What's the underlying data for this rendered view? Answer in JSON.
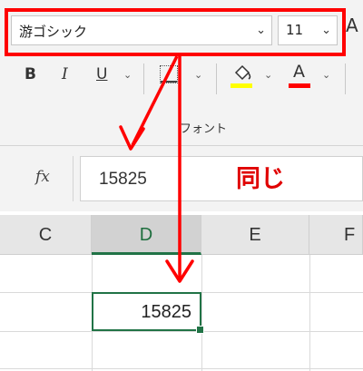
{
  "ribbon": {
    "font_name": "游ゴシック",
    "font_size": "11",
    "grow_font_glyph": "A",
    "bold": "B",
    "italic": "I",
    "underline": "U",
    "font_color_glyph": "A",
    "group_label": "フォント",
    "highlight_color": "#ffff00",
    "font_color": "#ff0000"
  },
  "formula_bar": {
    "fx_label": "fx",
    "value": "15825"
  },
  "annotation": {
    "label": "同じ",
    "color": "#e00000"
  },
  "sheet": {
    "columns": [
      "C",
      "D",
      "E",
      "F"
    ],
    "selected_column": "D",
    "active_cell_value": "15825",
    "accent": "#217346"
  }
}
